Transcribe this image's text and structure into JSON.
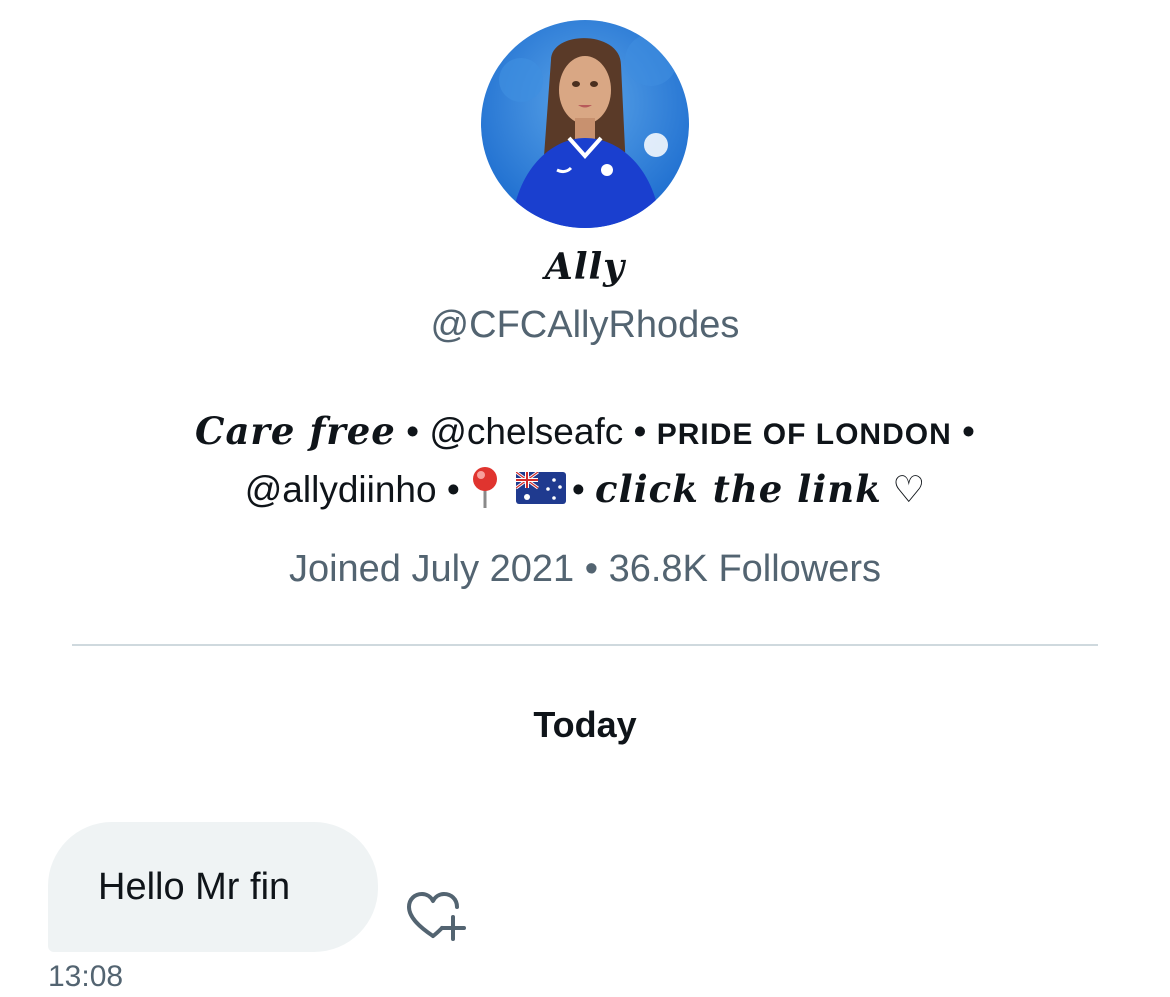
{
  "profile": {
    "display_name": "Ally",
    "handle": "@CFCAllyRhodes",
    "bio": {
      "part1": "Care free",
      "sep1": " • ",
      "mention1": "@chelseafc",
      "sep2": " • ",
      "part2": "PRIDE OF LONDON",
      "sep3": " •",
      "mention2": "@allydiinho",
      "sep4": " •",
      "sep5": "• ",
      "part3": "click the link",
      "heart": " ♡"
    },
    "meta": "Joined July 2021 • 36.8K Followers"
  },
  "conversation": {
    "date_label": "Today",
    "messages": [
      {
        "text": "Hello Mr fin",
        "time": "13:08"
      }
    ]
  },
  "icons": {
    "pin": "round-pushpin-icon",
    "flag": "australia-flag-icon",
    "react": "heart-plus-icon"
  },
  "colors": {
    "primary_text": "#0f1419",
    "secondary_text": "#536471",
    "bubble_bg": "#eff3f4",
    "divider": "#cfd9de"
  }
}
